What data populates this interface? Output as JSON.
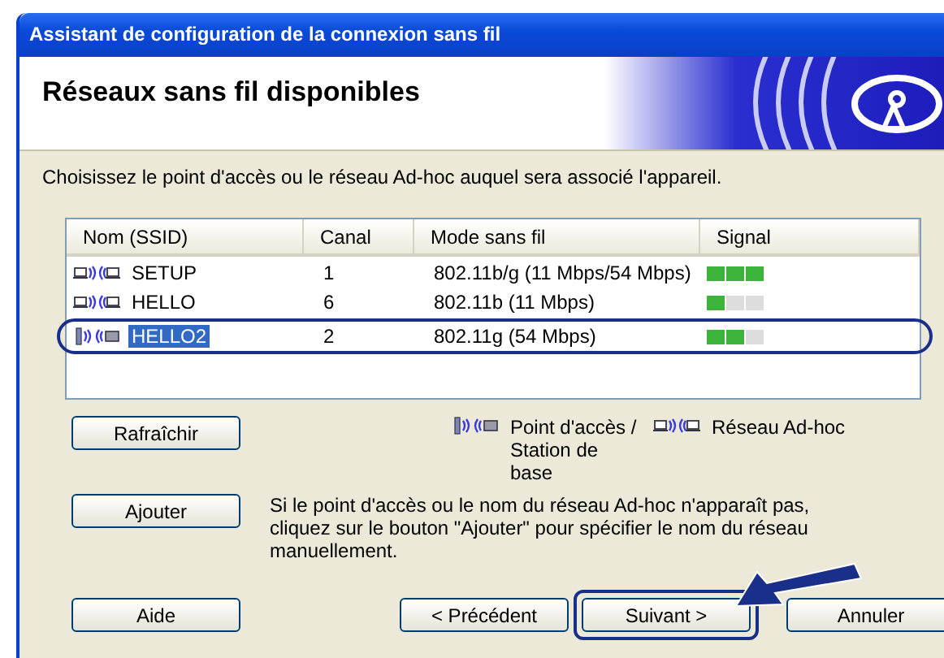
{
  "window": {
    "title": "Assistant de configuration de la connexion sans fil"
  },
  "header": {
    "title": "Réseaux sans fil disponibles"
  },
  "instruction": "Choisissez le point d'accès ou le réseau Ad-hoc auquel sera associé l'appareil.",
  "table": {
    "columns": [
      "Nom (SSID)",
      "Canal",
      "Mode sans fil",
      "Signal"
    ],
    "rows": [
      {
        "kind": "adhoc",
        "ssid": "SETUP",
        "channel": "1",
        "mode": "802.11b/g (11 Mbps/54 Mbps)",
        "level": 1,
        "selected": false
      },
      {
        "kind": "adhoc",
        "ssid": "HELLO",
        "channel": "6",
        "mode": "802.11b (11 Mbps)",
        "level": 0.33,
        "selected": false
      },
      {
        "kind": "ap",
        "ssid": "HELLO2",
        "channel": "2",
        "mode": "802.11g (54 Mbps)",
        "level": 0.67,
        "selected": true
      }
    ]
  },
  "legend": [
    {
      "kind": "ap",
      "label": "Point d'accès / Station de base"
    },
    {
      "kind": "adhoc",
      "label": "Réseau Ad-hoc"
    }
  ],
  "refresh_button": "Rafraîchir",
  "add_button": "Ajouter",
  "add_hint": "Si le point d'accès ou le nom du réseau Ad-hoc n'apparaît pas, cliquez sur le bouton \"Ajouter\" pour spécifier le nom du réseau manuellement.",
  "buttons": [
    {
      "label": "Aide",
      "kind": "help",
      "highlighted": false
    },
    {
      "label": "< Précédent",
      "kind": "nav",
      "highlighted": false
    },
    {
      "label": "Suivant >",
      "kind": "nav",
      "highlighted": true
    },
    {
      "label": "Annuler",
      "kind": "cancel",
      "highlighted": false
    }
  ]
}
